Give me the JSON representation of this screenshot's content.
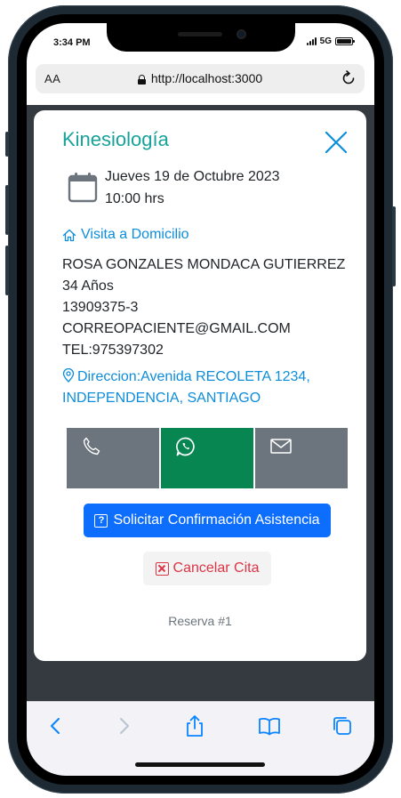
{
  "status_bar": {
    "time": "3:34 PM",
    "network": "5G"
  },
  "browser": {
    "aa_label": "AA",
    "url": "http://localhost:3000"
  },
  "modal": {
    "title": "Kinesiología",
    "date": "Jueves 19 de Octubre 2023",
    "time": "10:00 hrs",
    "visit_type": "Visita a Domicilio",
    "patient": {
      "name": "ROSA GONZALES MONDACA GUTIERREZ",
      "age": "34 Años",
      "id": "13909375-3",
      "email": "CORREOPACIENTE@GMAIL.COM",
      "phone": "TEL:975397302"
    },
    "address": "Direccion:Avenida RECOLETA 1234, INDEPENDENCIA, SANTIAGO",
    "confirm_button": "Solicitar Confirmación Asistencia",
    "cancel_button": "Cancelar Cita",
    "reservation": "Reserva #1"
  },
  "colors": {
    "title": "#17a29a",
    "link": "#0d8ddb",
    "primary": "#0d6efd",
    "danger": "#dc3545",
    "whatsapp": "#078651",
    "contact_gray": "#6c757d"
  },
  "icons": {
    "close": "close-icon",
    "calendar": "calendar-icon",
    "home": "home-icon",
    "location": "map-pin-icon",
    "phone": "phone-icon",
    "whatsapp": "whatsapp-icon",
    "email": "envelope-icon",
    "toolbar": [
      "back-icon",
      "forward-icon",
      "share-icon",
      "bookmarks-icon",
      "tabs-icon"
    ]
  }
}
